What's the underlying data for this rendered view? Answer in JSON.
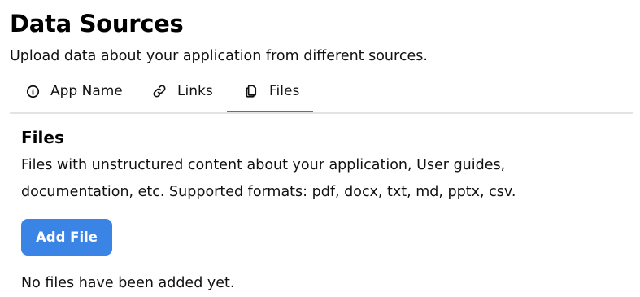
{
  "header": {
    "title": "Data Sources",
    "subtitle": "Upload data about your application from different sources."
  },
  "tabs": [
    {
      "label": "App Name",
      "icon": "info-circle-icon",
      "active": false
    },
    {
      "label": "Links",
      "icon": "link-icon",
      "active": false
    },
    {
      "label": "Files",
      "icon": "files-icon",
      "active": true
    }
  ],
  "files_section": {
    "title": "Files",
    "description": "Files with unstructured content about your application, User guides, documentation, etc. Supported formats: pdf, docx, txt, md, pptx, csv.",
    "add_button_label": "Add File",
    "empty_message": "No files have been added yet."
  },
  "colors": {
    "accent": "#3a84e5",
    "active_tab_underline": "#2d7be0",
    "divider": "#e3e3e3"
  }
}
